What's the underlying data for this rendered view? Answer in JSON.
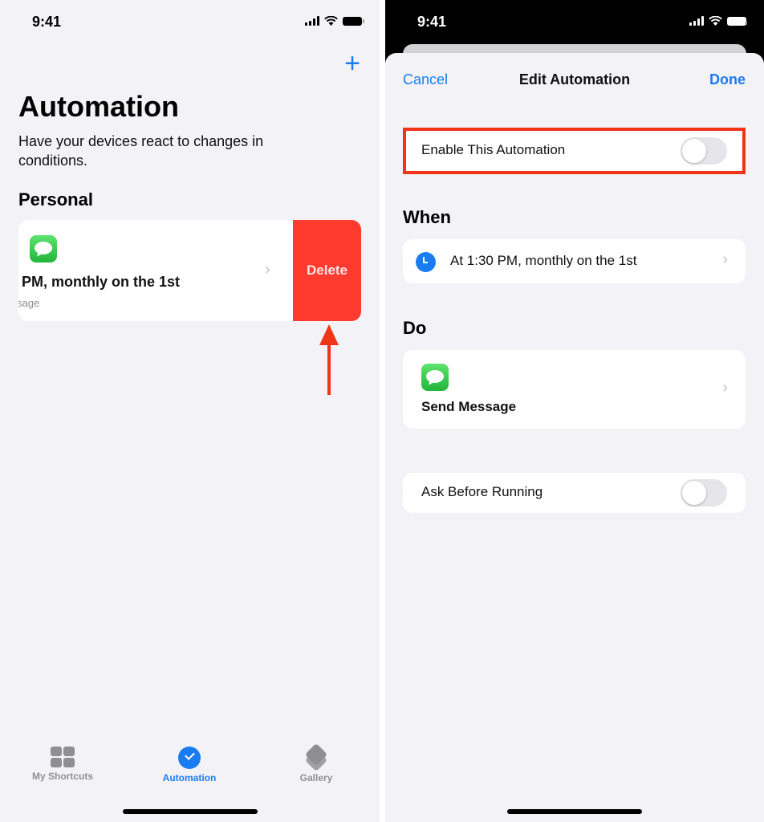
{
  "left": {
    "status": {
      "time": "9:41"
    },
    "add_icon": "plus-icon",
    "title": "Automation",
    "subtitle": "Have your devices react to changes in conditions.",
    "section": "Personal",
    "automation_card": {
      "trigger": "PM, monthly on the 1st",
      "action": "sage",
      "app_icon": "messages-icon",
      "delete_label": "Delete"
    },
    "tabs": [
      {
        "label": "My Shortcuts",
        "icon": "grid-icon",
        "active": false
      },
      {
        "label": "Automation",
        "icon": "clock-check-icon",
        "active": true
      },
      {
        "label": "Gallery",
        "icon": "layers-icon",
        "active": false
      }
    ]
  },
  "right": {
    "status": {
      "time": "9:41"
    },
    "nav": {
      "cancel": "Cancel",
      "title": "Edit Automation",
      "done": "Done"
    },
    "enable_row": {
      "label": "Enable This Automation",
      "on": false
    },
    "when": {
      "heading": "When",
      "trigger": "At 1:30 PM, monthly on the 1st"
    },
    "do": {
      "heading": "Do",
      "action": "Send Message"
    },
    "ask_row": {
      "label": "Ask Before Running",
      "on": false
    }
  },
  "colors": {
    "accent": "#1a7cf2",
    "delete": "#ff3b30",
    "annotation": "#f03418",
    "background": "#f2f2f7"
  }
}
